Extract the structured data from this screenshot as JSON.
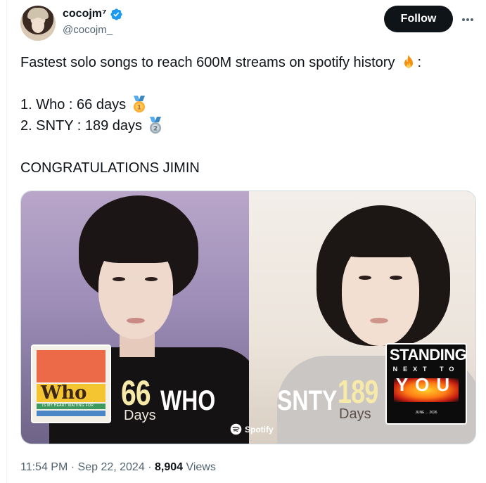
{
  "author": {
    "display_name": "cocojm⁷",
    "handle": "@cocojm_",
    "verified": true
  },
  "actions": {
    "follow_label": "Follow",
    "more_icon": "more-icon"
  },
  "tweet": {
    "line1": "Fastest solo songs to reach 600M streams on spotify history",
    "line1_suffix": ":",
    "line2": "1. Who : 66 days",
    "line3": "2. SNTY : 189 days",
    "line4": "CONGRATULATIONS JIMIN",
    "emojis": [
      "fire-emoji",
      "first-place-medal-emoji",
      "second-place-medal-emoji"
    ]
  },
  "media": {
    "left": {
      "album_word": "Who",
      "album_sub": "IS MY HEART WAITING FOR",
      "days_number": "66",
      "days_label": "Days",
      "song": "WHO"
    },
    "right": {
      "album_word1": "STANDING",
      "album_word2": "NEXT TO",
      "album_word3": "YOU",
      "album_date": "JUNE ... 2026",
      "days_number": "189",
      "days_label": "Days",
      "song": "SNTY"
    },
    "brand": "Spotify"
  },
  "meta": {
    "time": "11:54 PM",
    "separator": "·",
    "date": "Sep 22, 2024",
    "views_count": "8,904",
    "views_label": "Views"
  },
  "colors": {
    "text": "#0f1419",
    "secondary": "#536471",
    "verified": "#1d9bf0",
    "follow_bg": "#0f1419"
  }
}
